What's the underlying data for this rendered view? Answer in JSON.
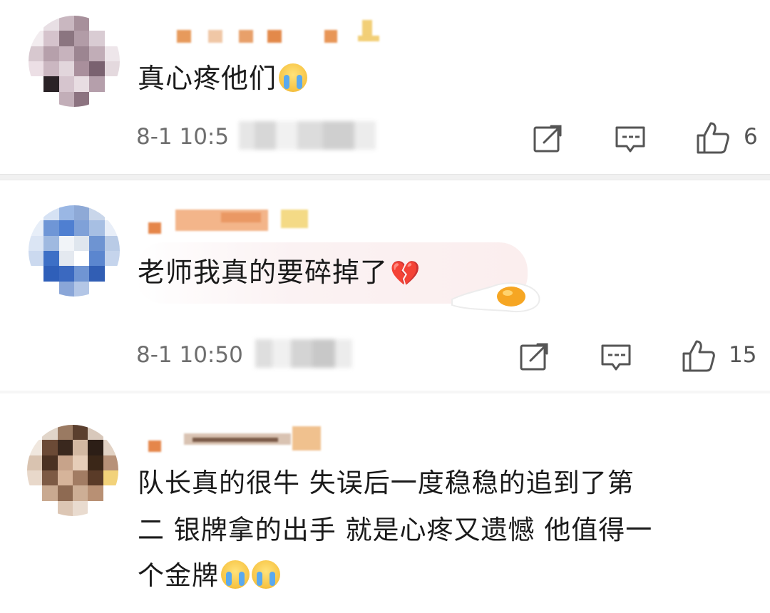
{
  "comments": [
    {
      "text": "真心疼他们",
      "emoji": "loudly-crying-face",
      "time": "8-1 10:5",
      "likes": "6"
    },
    {
      "text": "老师我真的要碎掉了",
      "emoji": "broken-heart",
      "time": "8-1 10:50",
      "likes": "15"
    },
    {
      "text_line1": "队长真的很牛 失误后一度稳稳的追到了第",
      "text_line2": "二 银牌拿的出手 就是心疼又遗憾 他值得一",
      "text_line3": "个金牌",
      "emoji": "crying-face"
    }
  ],
  "emoji_glyphs": {
    "broken_heart": "💔"
  },
  "colors": {
    "text": "#1a1a1a",
    "meta": "#6e6e6e",
    "icon": "#555555",
    "divider": "#f1f1f1"
  }
}
